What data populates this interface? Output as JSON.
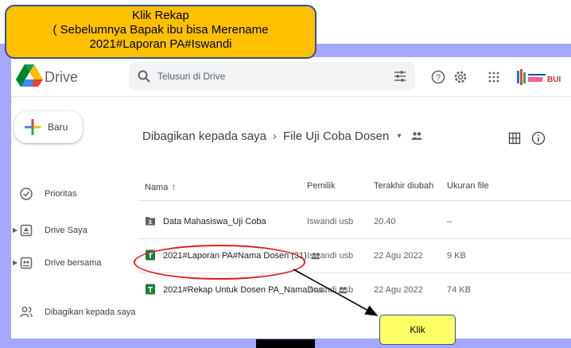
{
  "callout": {
    "line1": "Klik Rekap",
    "line2": "( Sebelumnya Bapak ibu bisa Merename",
    "line3": "2021#Laporan PA#Iswandi"
  },
  "app": {
    "brand": "Drive",
    "logo_icon": "google-drive-logo",
    "search_placeholder": "Telusuri di Drive",
    "top_icons": [
      "tune-icon",
      "help-icon",
      "settings-icon",
      "apps-grid-icon"
    ],
    "avatar_text": "BUI"
  },
  "sidebar": {
    "new_label": "Baru",
    "items": [
      {
        "label": "Prioritas",
        "icon": "check-circle-icon",
        "expandable": false
      },
      {
        "label": "Drive Saya",
        "icon": "my-drive-icon",
        "expandable": true
      },
      {
        "label": "Drive bersama",
        "icon": "shared-drive-icon",
        "expandable": true
      },
      {
        "label": "Dibagikan kepada saya",
        "icon": "shared-with-me-icon",
        "expandable": false
      }
    ]
  },
  "breadcrumb": {
    "root": "Dibagikan kepada saya",
    "separator": "›",
    "current": "File Uji Coba Dosen",
    "dropdown": "▾"
  },
  "table": {
    "headers": {
      "name": "Nama",
      "sort_arrow": "↑",
      "owner": "Pemilik",
      "modified": "Terakhir diubah",
      "size": "Ukuran file"
    },
    "rows": [
      {
        "name": "Data Mahasiswa_Uji Coba",
        "type": "shared-folder",
        "shared": false,
        "owner": "Iswandi usb",
        "modified": "20.40",
        "size": "–"
      },
      {
        "name": "2021#Laporan PA#Nama Dosen (31)",
        "type": "sheet",
        "shared": true,
        "owner": "Iswandi usb",
        "modified": "22 Agu 2022",
        "size": "9 KB"
      },
      {
        "name": "2021#Rekap Untuk Dosen PA_NamaDos...",
        "type": "sheet",
        "shared": true,
        "owner": "Iswandi usb",
        "modified": "22 Agu 2022",
        "size": "74 KB"
      }
    ]
  },
  "annotation": {
    "klik_label": "Klik"
  },
  "colors": {
    "callout_bg": "#ffc000",
    "frame_bg": "#a4a8ff",
    "ellipse": "#e0201b",
    "klik_bg": "#ffff66",
    "sheet_green": "#188038"
  }
}
